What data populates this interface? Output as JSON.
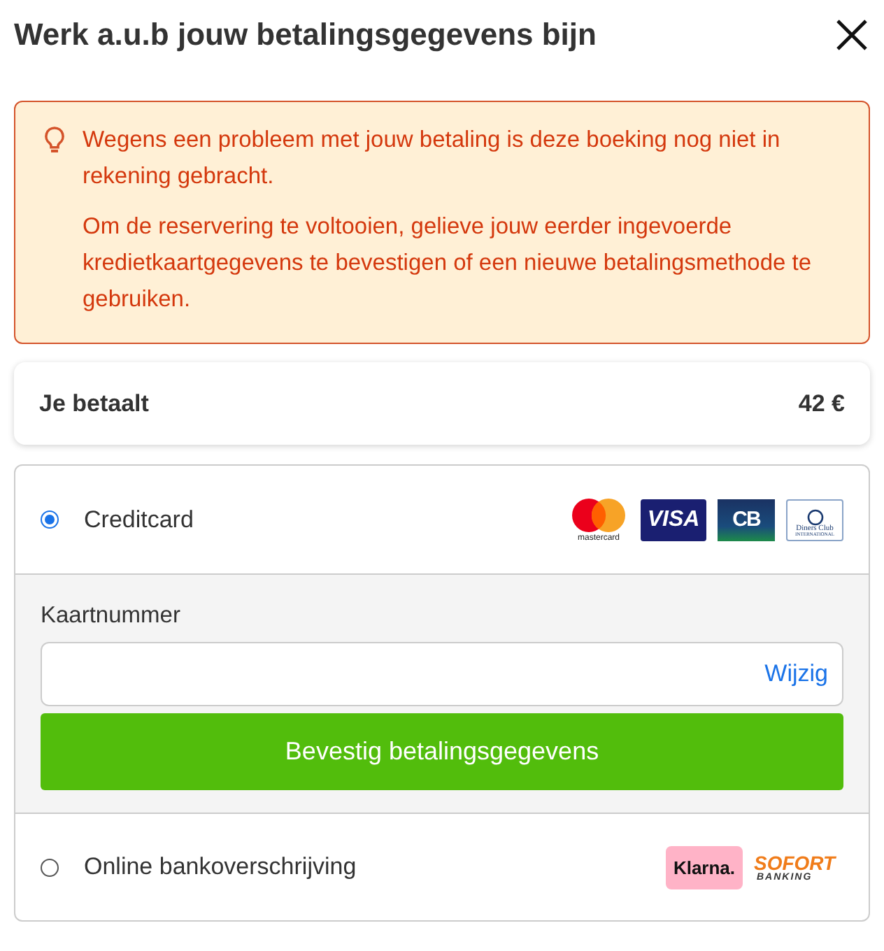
{
  "title": "Werk a.u.b jouw betalingsgegevens bijn",
  "alert": {
    "paragraphs": [
      "Wegens een probleem met jouw betaling is deze boeking nog niet in rekening gebracht.",
      "Om de reservering te voltooien, gelieve jouw eerder ingevoerde kredietkaartgegevens te bevestigen of een nieuwe betalingsmethode te gebruiken."
    ]
  },
  "total": {
    "label": "Je betaalt",
    "amount": "42 €"
  },
  "methods": [
    {
      "label": "Creditcard",
      "selected": true,
      "logos": [
        {
          "kind": "mastercard",
          "text": "mastercard"
        },
        {
          "kind": "visa",
          "text": "VISA"
        },
        {
          "kind": "cb",
          "text": "CB"
        },
        {
          "kind": "diners",
          "text": "Diners Club",
          "subtext": "INTERNATIONAL"
        }
      ],
      "form": {
        "field_label": "Kaartnummer",
        "link": "Wijzig",
        "button": "Bevestig betalingsgegevens"
      }
    },
    {
      "label": "Online bankoverschrijving",
      "selected": false,
      "logos": [
        {
          "kind": "klarna",
          "text": "Klarna."
        },
        {
          "kind": "sofort",
          "text": "SOFORT",
          "subtext": "BANKING"
        }
      ]
    }
  ]
}
